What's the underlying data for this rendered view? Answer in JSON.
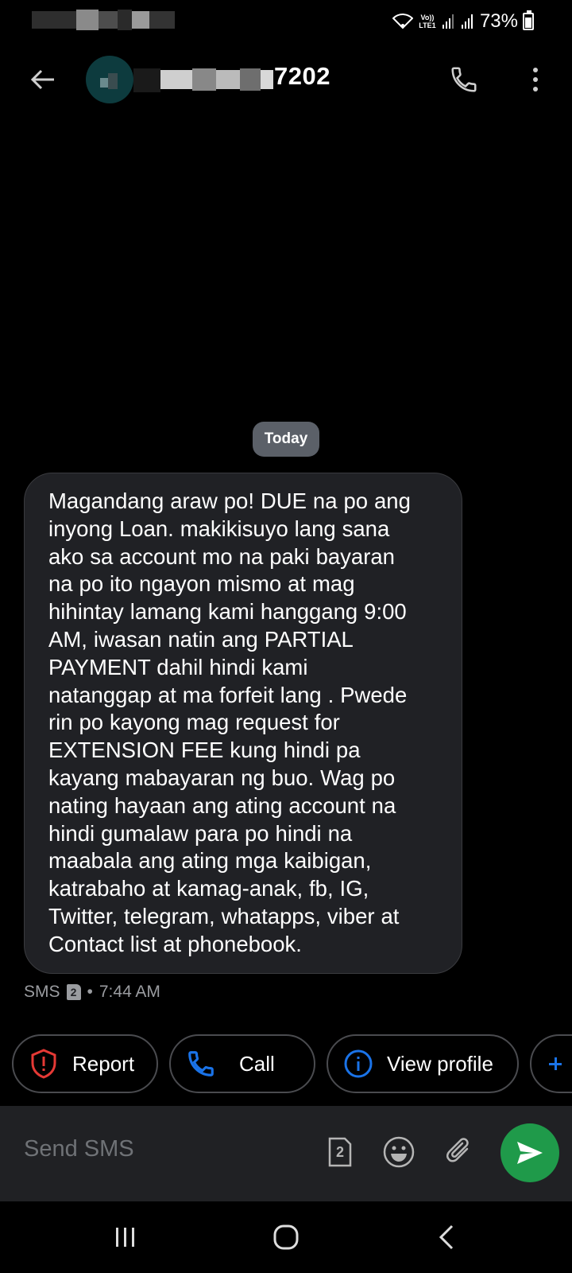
{
  "status_bar": {
    "network_label": "Vo)) LTE1",
    "battery": "73%"
  },
  "header": {
    "contact_suffix": "7202",
    "icons": [
      "back-arrow-icon",
      "phone-icon",
      "more-vert-icon"
    ]
  },
  "conversation": {
    "date_chip": "Today",
    "message": {
      "lines": [
        "Magandang araw po! DUE na po ang",
        "inyong Loan. makikisuyo lang sana",
        "ako sa account mo na paki bayaran",
        "na po ito ngayon mismo at mag",
        "hihintay lamang kami hanggang 9:00",
        "AM, iwasan natin ang PARTIAL",
        "PAYMENT dahil hindi kami",
        "natanggap at ma forfeit lang . Pwede",
        "rin po kayong mag request for",
        "EXTENSION FEE kung hindi pa",
        "kayang mabayaran ng buo. Wag po",
        "nating hayaan ang ating account na",
        "hindi gumalaw para po hindi na",
        "maabala ang ating mga kaibigan,",
        "katrabaho at kamag-anak, fb, IG,",
        "Twitter, telegram, whatapps, viber at",
        "Contact list at phonebook."
      ],
      "type": "SMS",
      "sim": "2",
      "separator": "•",
      "time": "7:44 AM"
    }
  },
  "actions": {
    "report": "Report",
    "call": "Call",
    "view_profile": "View profile"
  },
  "compose": {
    "placeholder": "Send SMS",
    "sim": "2"
  },
  "colors": {
    "background": "#000000",
    "bubble": "#202125",
    "send": "#1f9a4a",
    "report_icon": "#e53935",
    "accent_blue": "#1a73e8"
  }
}
